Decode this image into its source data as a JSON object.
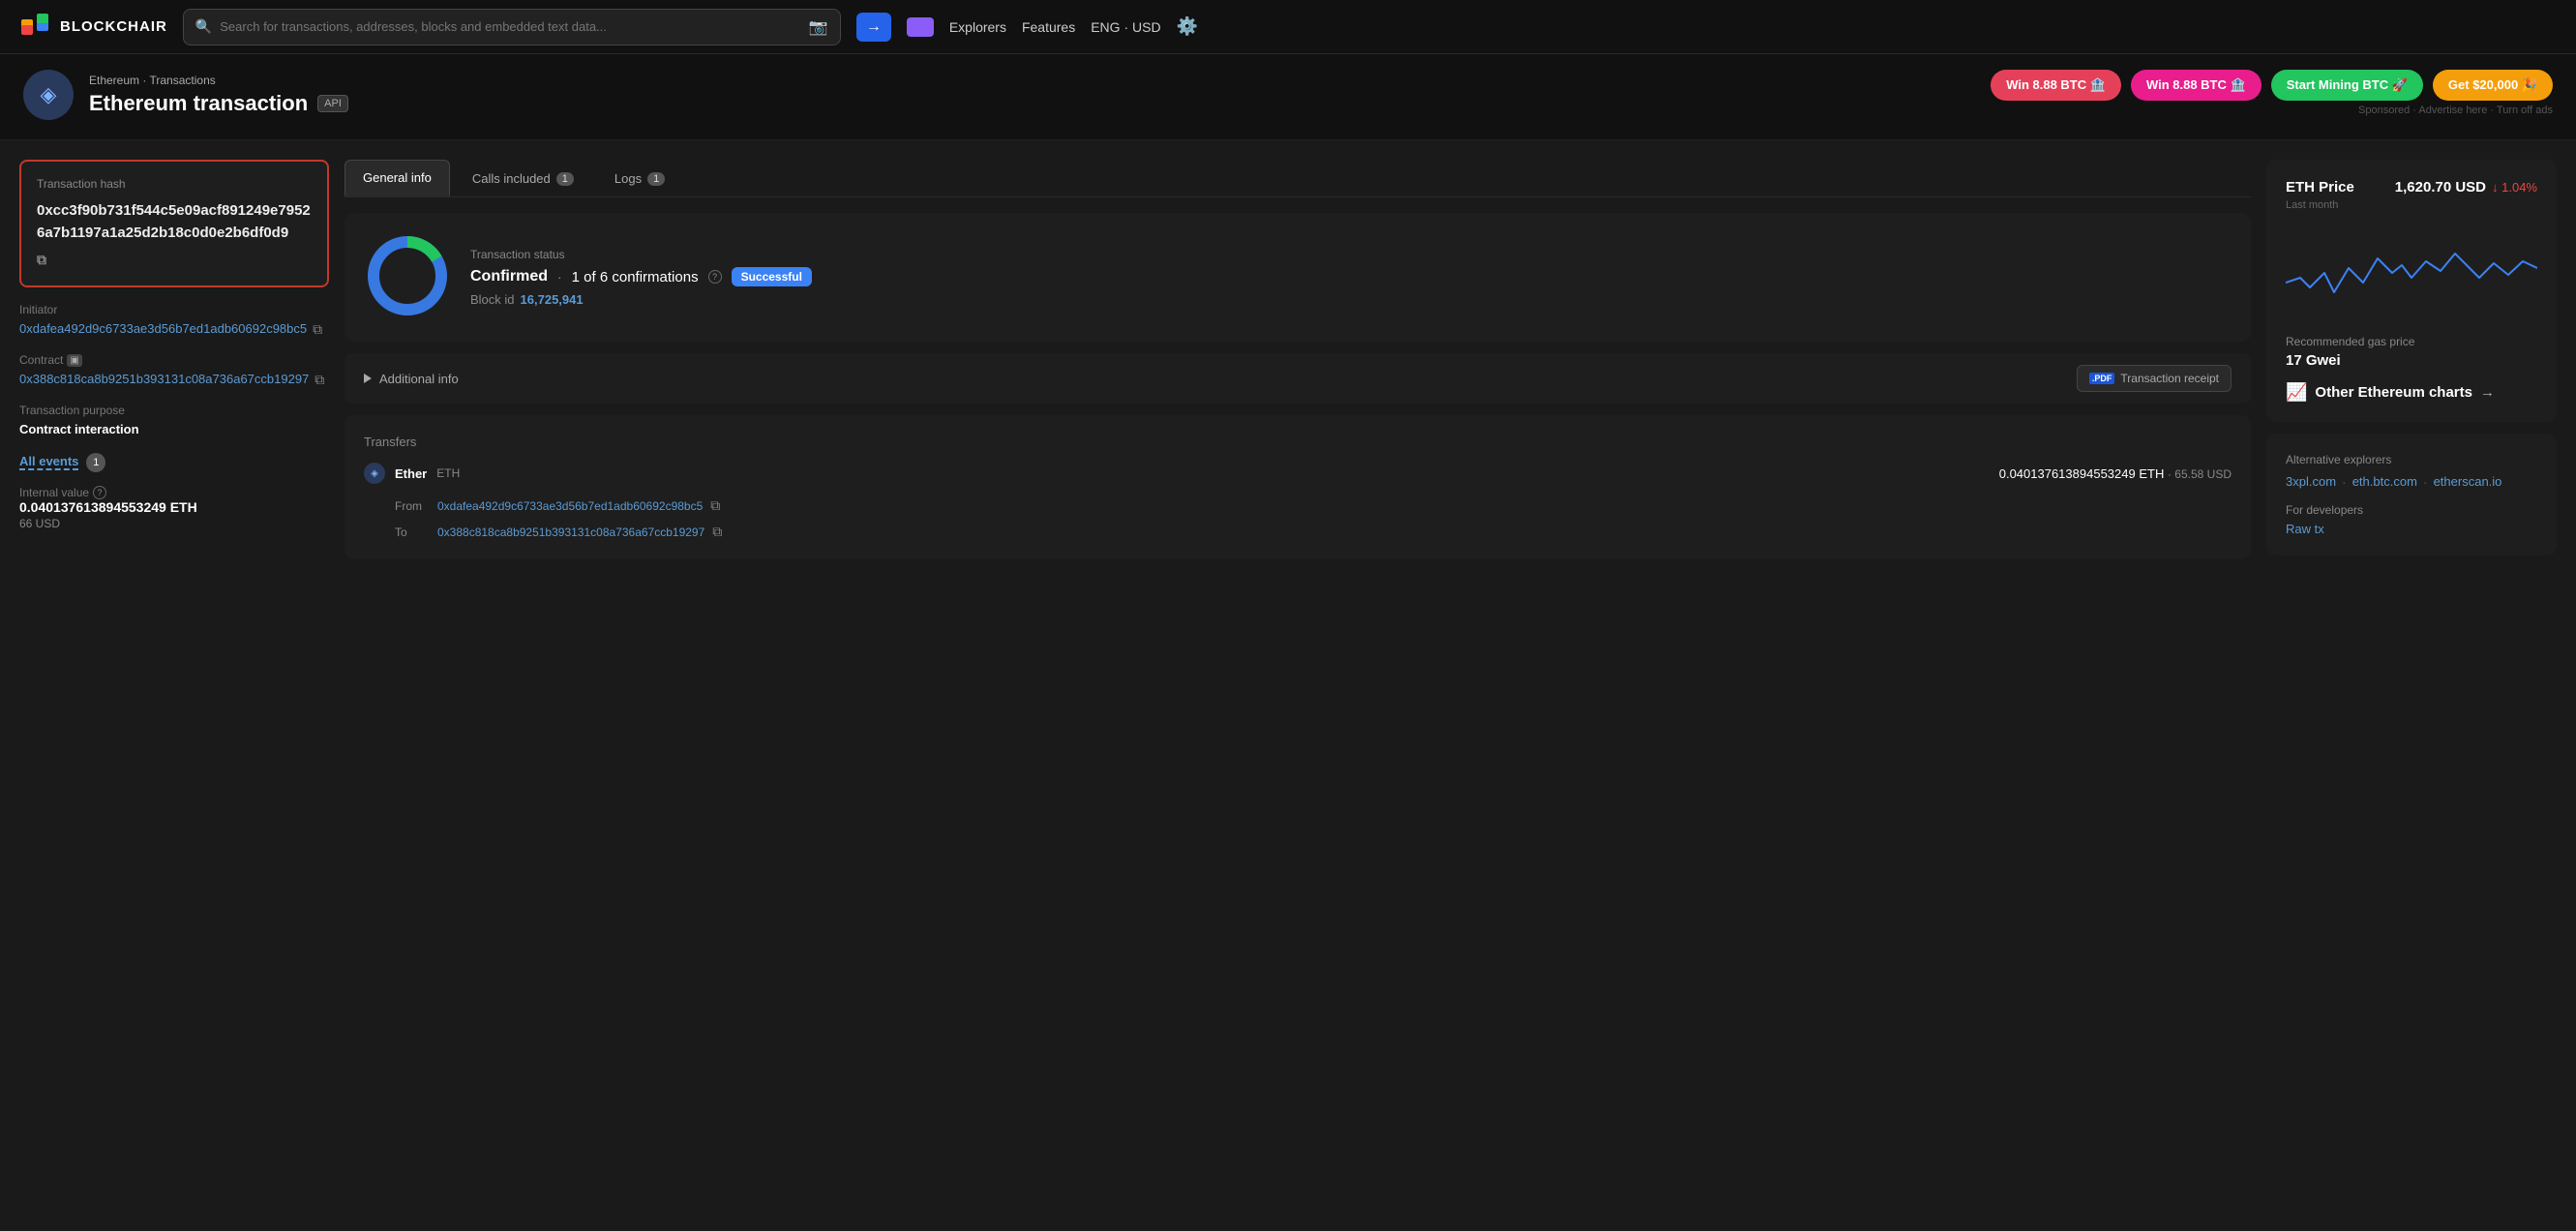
{
  "header": {
    "logo_text": "BLOCKCHAIR",
    "search_placeholder": "Search for transactions, addresses, blocks and embedded text data...",
    "search_btn_icon": "→",
    "nav_explorers": "Explorers",
    "nav_features": "Features",
    "nav_lang": "ENG",
    "nav_currency": "USD"
  },
  "page_header": {
    "breadcrumb_chain": "Ethereum",
    "breadcrumb_sep": "·",
    "breadcrumb_section": "Transactions",
    "title": "Ethereum transaction",
    "api_label": "API",
    "promo": [
      {
        "label": "Win 8.88 BTC 🏦",
        "style": "red"
      },
      {
        "label": "Win 8.88 BTC 🏦",
        "style": "pink"
      },
      {
        "label": "Start Mining BTC 🚀",
        "style": "green"
      },
      {
        "label": "Get $20,000 🎉",
        "style": "orange"
      }
    ],
    "sponsored": "Sponsored · Advertise here · Turn off ads"
  },
  "left_panel": {
    "tx_hash_label": "Transaction hash",
    "tx_hash": "0xcc3f90b731f544c5e09acf891249e79526a7b1197a1a25d2b18c0d0e2b6df0d9",
    "initiator_label": "Initiator",
    "initiator_addr": "0xdafea492d9c6733ae3d56b7ed1adb60692c98bc5",
    "contract_label": "Contract",
    "contract_addr": "0x388c818ca8b9251b393131c08a736a67ccb19297",
    "tx_purpose_label": "Transaction purpose",
    "tx_purpose": "Contract interaction",
    "all_events_label": "All events",
    "all_events_count": "1",
    "internal_value_label": "Internal value",
    "internal_value": "0.040137613894553249 ETH",
    "internal_value_usd": "66 USD"
  },
  "center_panel": {
    "tabs": [
      {
        "label": "General info",
        "count": null,
        "active": true
      },
      {
        "label": "Calls included",
        "count": "1",
        "active": false
      },
      {
        "label": "Logs",
        "count": "1",
        "active": false
      }
    ],
    "tx_status_title": "Transaction status",
    "tx_status_confirmed": "Confirmed",
    "tx_status_sep": "·",
    "tx_confirmations": "1 of 6 confirmations",
    "tx_status_badge": "Successful",
    "block_id_label": "Block id",
    "block_id_value": "16,725,941",
    "additional_info_label": "Additional info",
    "pdf_label": ".PDF",
    "tx_receipt_label": "Transaction receipt",
    "transfers_title": "Transfers",
    "transfer_name": "Ether",
    "transfer_ticker": "ETH",
    "transfer_amount": "0.040137613894553249 ETH",
    "transfer_usd": "65.58 USD",
    "from_label": "From",
    "to_label": "To",
    "from_addr": "0xdafea492d9c6733ae3d56b7ed1adb60692c98bc5",
    "to_addr": "0x388c818ca8b9251b393131c08a736a67ccb19297",
    "pie_confirmed_pct": 16.7,
    "pie_remaining_pct": 83.3
  },
  "right_panel": {
    "eth_price_title": "ETH Price",
    "eth_price_value": "1,620.70 USD",
    "eth_price_change": "↓ 1.04%",
    "last_month": "Last month",
    "gas_label": "Recommended gas price",
    "gas_value": "17 Gwei",
    "other_charts_label": "Other Ethereum charts",
    "alt_explorers_title": "Alternative explorers",
    "alt_links": [
      "3xpl.com",
      "eth.btc.com",
      "etherscan.io"
    ],
    "dev_label": "For developers",
    "raw_tx_label": "Raw tx"
  }
}
